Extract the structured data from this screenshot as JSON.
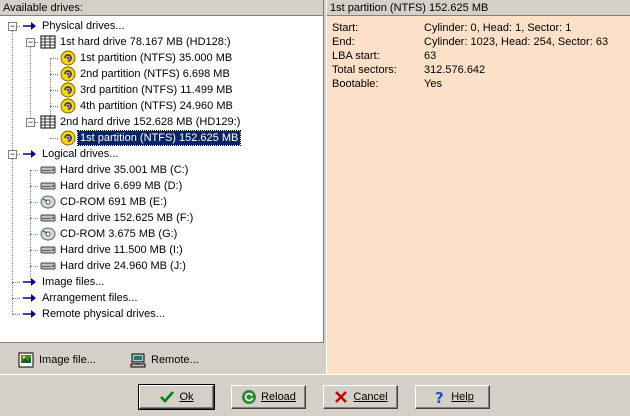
{
  "left_panel": {
    "header": "Available drives:",
    "tree": [
      {
        "label": "Physical drives...",
        "icon": "arrow-right-icon",
        "level": 1,
        "expander": "−"
      },
      {
        "label": "1st hard drive 78.167 MB (HD128:)",
        "icon": "hard-drive-grid-icon",
        "level": 2,
        "expander": "−"
      },
      {
        "label": "1st partition (NTFS) 35.000 MB",
        "icon": "partition-icon",
        "level": 3
      },
      {
        "label": "2nd partition (NTFS) 6.698 MB",
        "icon": "partition-icon",
        "level": 3
      },
      {
        "label": "3rd partition (NTFS) 11.499 MB",
        "icon": "partition-icon",
        "level": 3
      },
      {
        "label": "4th partition (NTFS) 24.960 MB",
        "icon": "partition-icon",
        "level": 3
      },
      {
        "label": "2nd hard drive 152.628 MB (HD129:)",
        "icon": "hard-drive-grid-icon",
        "level": 2,
        "expander": "−"
      },
      {
        "label": "1st partition (NTFS) 152.625 MB",
        "icon": "partition-icon",
        "level": 3,
        "selected": true
      },
      {
        "label": "Logical drives...",
        "icon": "arrow-right-icon",
        "level": 1,
        "expander": "−"
      },
      {
        "label": "Hard drive 35.001 MB (C:)",
        "icon": "disk-drive-icon",
        "level": 2
      },
      {
        "label": "Hard drive 6.699 MB (D:)",
        "icon": "disk-drive-icon",
        "level": 2
      },
      {
        "label": "CD-ROM 691 MB (E:)",
        "icon": "cdrom-icon",
        "level": 2
      },
      {
        "label": "Hard drive 152.625 MB (F:)",
        "icon": "disk-drive-icon",
        "level": 2
      },
      {
        "label": "CD-ROM 3.675 MB (G:)",
        "icon": "cdrom-icon",
        "level": 2
      },
      {
        "label": "Hard drive 11.500 MB (I:)",
        "icon": "disk-drive-icon",
        "level": 2
      },
      {
        "label": "Hard drive 24.960 MB (J:)",
        "icon": "disk-drive-icon",
        "level": 2
      },
      {
        "label": "Image files...",
        "icon": "arrow-right-icon",
        "level": 1
      },
      {
        "label": "Arrangement files...",
        "icon": "arrow-right-icon",
        "level": 1
      },
      {
        "label": "Remote physical drives...",
        "icon": "arrow-right-icon",
        "level": 1
      }
    ],
    "footer": {
      "image_file_label": "Image file...",
      "remote_label": "Remote..."
    }
  },
  "right_panel": {
    "header": "1st partition (NTFS) 152.625 MB",
    "properties": [
      {
        "key": "Start:",
        "value": "Cylinder: 0, Head: 1, Sector: 1"
      },
      {
        "key": "End:",
        "value": "Cylinder: 1023, Head: 254, Sector: 63"
      },
      {
        "key": "LBA start:",
        "value": "63"
      },
      {
        "key": "Total sectors:",
        "value": "312.576.642"
      },
      {
        "key": "Bootable:",
        "value": "Yes"
      }
    ]
  },
  "buttons": {
    "ok": "Ok",
    "reload": "Reload",
    "cancel": "Cancel",
    "help": "Help"
  },
  "colors": {
    "details_background": "#fce0c8",
    "selection": "#0a246a",
    "dialog": "#d4d0c8"
  }
}
